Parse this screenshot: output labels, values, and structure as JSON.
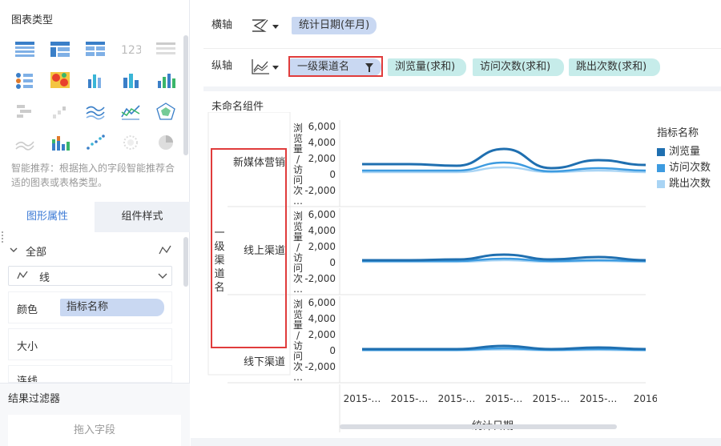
{
  "left_panel": {
    "chart_types_title": "图表类型",
    "hint": "智能推荐：根据拖入的字段智能推荐合适的图表或表格类型。",
    "tabs": [
      "图形属性",
      "组件样式"
    ],
    "all_label": "全部",
    "mark_type": "线",
    "color_label": "颜色",
    "color_field": "指标名称",
    "size_label": "大小",
    "clipped_label": "连线",
    "filter_title": "结果过滤器",
    "drop_field": "拖入字段"
  },
  "axes": {
    "x_label": "横轴",
    "x_field": "统计日期(年月)",
    "y_label": "纵轴",
    "y_fields": [
      "一级渠道名",
      "浏览量(求和)",
      "访问次数(求和)",
      "跳出次数(求和)"
    ]
  },
  "widget": {
    "title": "未命名组件",
    "row_dim_label": "一级渠道名",
    "rows": [
      "新媒体营销",
      "线上渠道",
      "线下渠道"
    ],
    "y_axis_title": "浏览量/访问次…",
    "y_ticks": [
      "6,000",
      "4,000",
      "2,000",
      "0",
      "-2,000"
    ],
    "x_ticks": [
      "2015-…",
      "2015-…",
      "2015-…",
      "2015-…",
      "2015-…",
      "2015-…",
      "2016"
    ],
    "x_axis_title": "统计日期",
    "legend_title": "指标名称",
    "legend": [
      {
        "name": "浏览量",
        "color": "#1f6fb0"
      },
      {
        "name": "访问次数",
        "color": "#3d9be0"
      },
      {
        "name": "跳出次数",
        "color": "#a9d4f4"
      }
    ]
  },
  "colors": {
    "accent": "#3d7bd6",
    "pill_blue": "#c9d8f2",
    "pill_green": "#c6ecea",
    "highlight": "#e03c3c"
  },
  "chart_data": {
    "type": "line",
    "x": [
      "2015-…",
      "2015-…",
      "2015-…",
      "2015-…",
      "2015-…",
      "2015-…",
      "2016"
    ],
    "ylim": [
      -2000,
      6000
    ],
    "panels": [
      {
        "name": "新媒体营销",
        "series": [
          {
            "name": "浏览量",
            "values": [
              1300,
              1300,
              1100,
              3200,
              800,
              1800,
              1200
            ]
          },
          {
            "name": "访问次数",
            "values": [
              500,
              500,
              500,
              1500,
              400,
              800,
              500
            ]
          },
          {
            "name": "跳出次数",
            "values": [
              300,
              300,
              300,
              900,
              300,
              500,
              300
            ]
          }
        ]
      },
      {
        "name": "线上渠道",
        "series": [
          {
            "name": "浏览量",
            "values": [
              300,
              300,
              400,
              1000,
              400,
              700,
              300
            ]
          },
          {
            "name": "访问次数",
            "values": [
              200,
              200,
              200,
              500,
              200,
              300,
              200
            ]
          },
          {
            "name": "跳出次数",
            "values": [
              100,
              100,
              100,
              300,
              100,
              200,
              100
            ]
          }
        ]
      },
      {
        "name": "线下渠道",
        "series": [
          {
            "name": "浏览量",
            "values": [
              200,
              200,
              200,
              600,
              200,
              400,
              200
            ]
          },
          {
            "name": "访问次数",
            "values": [
              100,
              100,
              100,
              300,
              100,
              200,
              100
            ]
          },
          {
            "name": "跳出次数",
            "values": [
              50,
              50,
              50,
              150,
              50,
              100,
              50
            ]
          }
        ]
      }
    ]
  }
}
